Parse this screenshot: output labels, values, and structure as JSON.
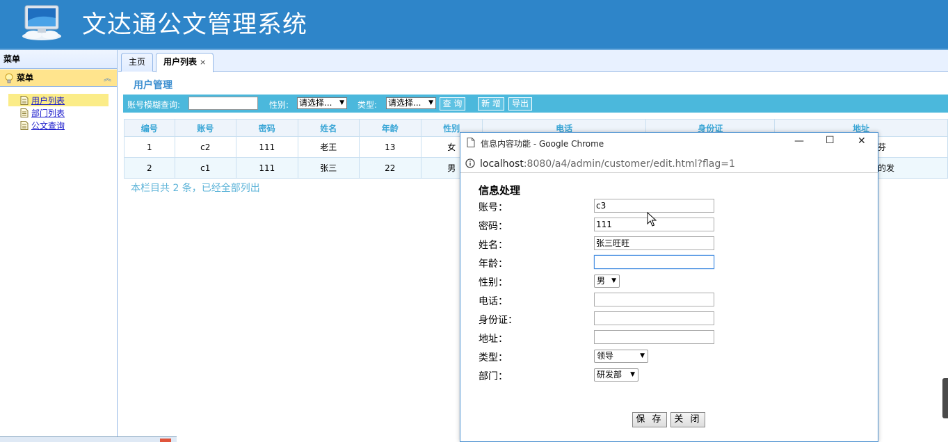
{
  "app": {
    "title": "文达通公文管理系统"
  },
  "sidebar": {
    "title": "菜单",
    "group_title": "菜单",
    "items": [
      {
        "label": "用户列表",
        "active": true
      },
      {
        "label": "部门列表",
        "active": false
      },
      {
        "label": "公文查询",
        "active": false
      }
    ]
  },
  "tabs": [
    {
      "label": "主页",
      "selected": false
    },
    {
      "label": "用户列表",
      "selected": true,
      "close": "×"
    }
  ],
  "main": {
    "section_title": "用户管理",
    "search": {
      "account_label": "账号模糊查询:",
      "account_value": "",
      "gender_label": "性别:",
      "gender_selected": "请选择...",
      "type_label": "类型:",
      "type_selected": "请选择...",
      "query_button": "查 询",
      "add_button": "新 增",
      "export_button": "导出"
    },
    "table": {
      "columns": [
        "编号",
        "账号",
        "密码",
        "姓名",
        "年龄",
        "性别",
        "电话",
        "身份证",
        "地址"
      ],
      "rows": [
        [
          "1",
          "c2",
          "111",
          "老王",
          "13",
          "女",
          "",
          "",
          "大沙发斯蒂芬"
        ],
        [
          "2",
          "c1",
          "111",
          "张三",
          "22",
          "男",
          "",
          "",
          "的发的说法是的发"
        ]
      ]
    },
    "count_text": "本栏目共 2 条，已经全部列出"
  },
  "popup": {
    "window_title": "信息内容功能 - Google Chrome",
    "url_host": "localhost",
    "url_rest": ":8080/a4/admin/customer/edit.html?flag=1",
    "form_title": "信息处理",
    "fields": [
      {
        "label": "账号：",
        "value": "c3",
        "kind": "input"
      },
      {
        "label": "密码：",
        "value": "111",
        "kind": "input"
      },
      {
        "label": "姓名：",
        "value": "张三旺旺",
        "kind": "input"
      },
      {
        "label": "年龄：",
        "value": "",
        "kind": "input-focus"
      },
      {
        "label": "性别：",
        "value": "男",
        "kind": "select"
      },
      {
        "label": "电话：",
        "value": "",
        "kind": "input"
      },
      {
        "label": "身份证：",
        "value": "",
        "kind": "input"
      },
      {
        "label": "地址：",
        "value": "",
        "kind": "input"
      },
      {
        "label": "类型：",
        "value": "领导",
        "kind": "select"
      },
      {
        "label": "部门：",
        "value": "研发部",
        "kind": "select"
      }
    ],
    "save_button": "保 存",
    "close_button": "关 闭"
  },
  "colors": {
    "header": "#2e85c9",
    "search_bar": "#4bb8dc",
    "menu_active": "#fbec88",
    "accordion_header": "#ffe48d",
    "table_header_text": "#3aa6d6"
  },
  "icons": [
    "monitor-logo-icon",
    "lightbulb-icon",
    "collapse-icon",
    "document-icon",
    "info-icon",
    "minimize-icon",
    "maximize-icon",
    "close-icon",
    "mouse-cursor-icon"
  ]
}
